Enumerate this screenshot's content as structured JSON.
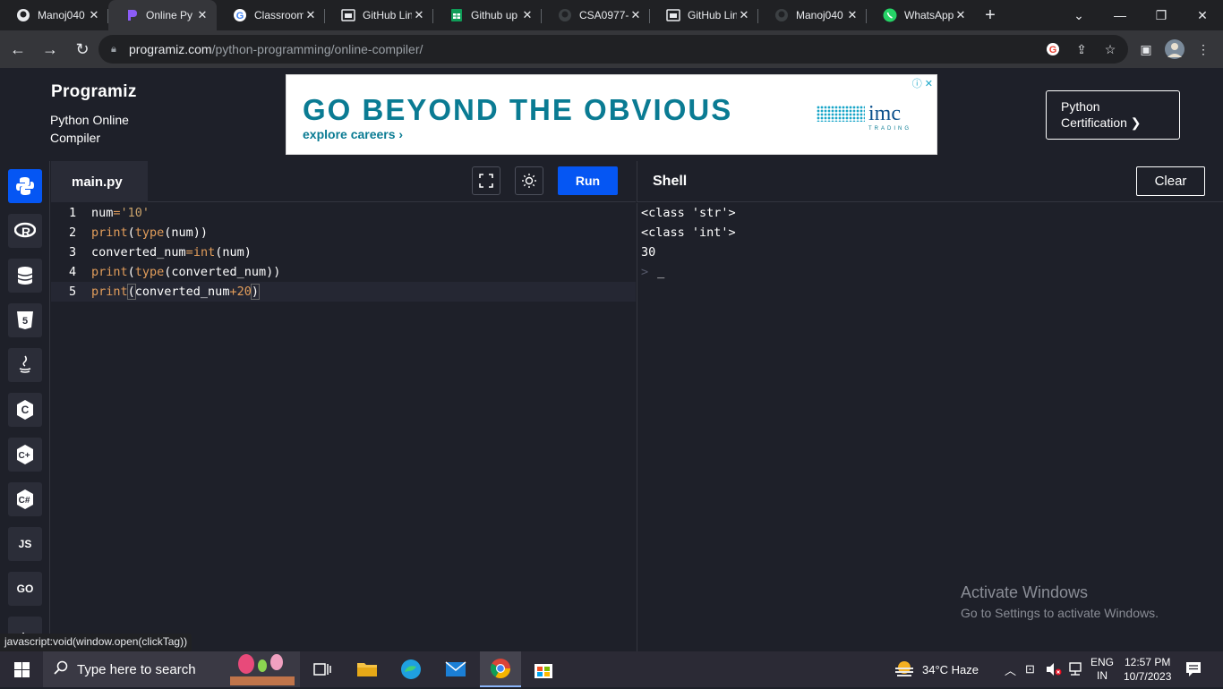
{
  "browser": {
    "tabs": [
      {
        "title": "Manoj040",
        "icon": "github-icon"
      },
      {
        "title": "Online Py",
        "icon": "programiz-icon",
        "active": true
      },
      {
        "title": "Classroom",
        "icon": "google-icon"
      },
      {
        "title": "GitHub Lin",
        "icon": "page-icon"
      },
      {
        "title": "Github up",
        "icon": "sheets-icon"
      },
      {
        "title": "CSA0977-",
        "icon": "github-icon"
      },
      {
        "title": "GitHub Lin",
        "icon": "page-icon"
      },
      {
        "title": "Manoj040",
        "icon": "github-icon"
      },
      {
        "title": "WhatsApp",
        "icon": "whatsapp-icon"
      }
    ],
    "url_host": "programiz.com",
    "url_path": "/python-programming/online-compiler/",
    "status_link": "javascript:void(window.open(clickTag))"
  },
  "site": {
    "logo": "Programiz",
    "subtitle": "Python Online Compiler",
    "cert_button": "Python Certification ❯",
    "ad": {
      "headline": "GO BEYOND THE OBVIOUS",
      "sub": "explore careers  ›",
      "brand": "imc",
      "brand_sub": "TRADING"
    }
  },
  "languages": [
    "python",
    "r",
    "sql",
    "html5",
    "java",
    "c",
    "c++",
    "c#",
    "JS",
    "GO",
    "php"
  ],
  "editor": {
    "filename": "main.py",
    "run_label": "Run",
    "lines": [
      {
        "n": "1"
      },
      {
        "n": "2"
      },
      {
        "n": "3"
      },
      {
        "n": "4"
      },
      {
        "n": "5"
      }
    ]
  },
  "shell": {
    "title": "Shell",
    "clear_label": "Clear",
    "output": [
      "<class 'str'>",
      "<class 'int'>",
      "30"
    ],
    "prompt": ">",
    "cursor": "_"
  },
  "watermark": {
    "line1": "Activate Windows",
    "line2": "Go to Settings to activate Windows."
  },
  "taskbar": {
    "search_placeholder": "Type here to search",
    "weather": "34°C  Haze",
    "lang": "ENG",
    "region": "IN",
    "time": "12:57 PM",
    "date": "10/7/2023"
  },
  "colors": {
    "run": "#0556f3",
    "background": "#1e2029",
    "keyword": "#e29d5b"
  }
}
